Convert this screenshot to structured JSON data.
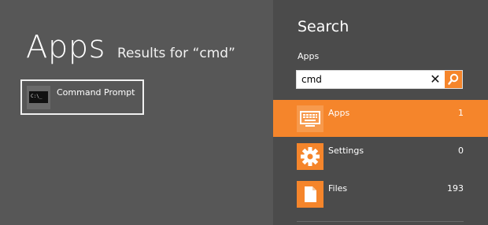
{
  "results": {
    "title": "Apps",
    "subtitle": "Results for “cmd”",
    "items": [
      {
        "label": "Command Prompt",
        "icon": "command-prompt-icon",
        "icon_text": "C:\\_"
      }
    ]
  },
  "charm": {
    "title": "Search",
    "scope": "Apps",
    "query": "cmd",
    "clear_glyph": "✕",
    "categories": [
      {
        "label": "Apps",
        "count": "1",
        "icon": "apps-keyboard-icon",
        "selected": true
      },
      {
        "label": "Settings",
        "count": "0",
        "icon": "settings-gear-icon",
        "selected": false
      },
      {
        "label": "Files",
        "count": "193",
        "icon": "file-icon",
        "selected": false
      }
    ]
  },
  "colors": {
    "accent": "#f5852b",
    "left_bg": "#575757",
    "charm_bg": "#4b4b4b"
  }
}
